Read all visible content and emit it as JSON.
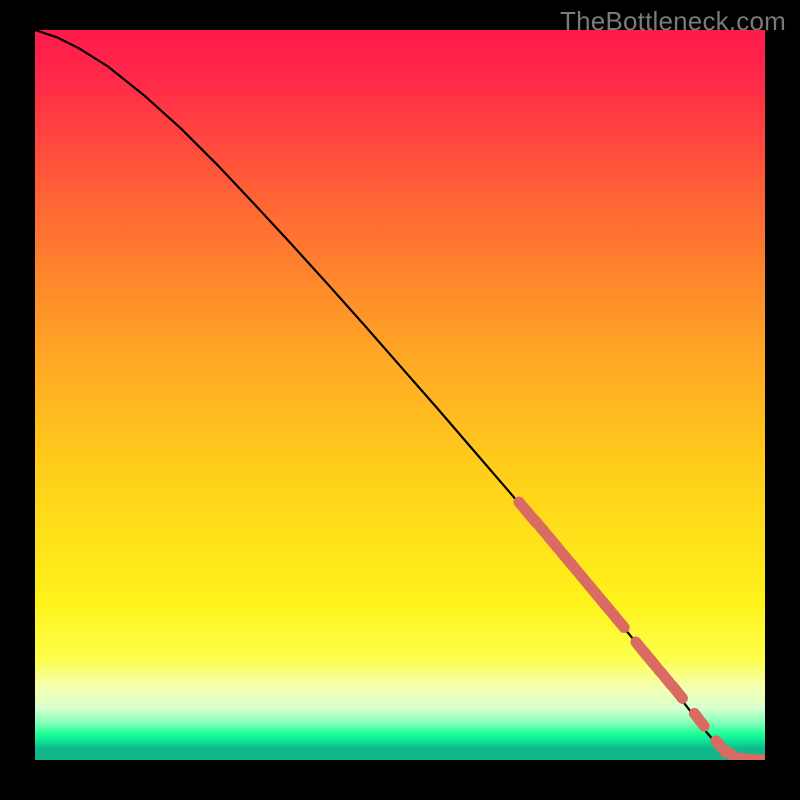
{
  "watermark": "TheBottleneck.com",
  "colors": {
    "background": "#000000",
    "gradient_stops": [
      {
        "offset": 0.0,
        "color": "#ff1a4d"
      },
      {
        "offset": 0.07,
        "color": "#ff2a48"
      },
      {
        "offset": 0.25,
        "color": "#ff6a33"
      },
      {
        "offset": 0.45,
        "color": "#ffa824"
      },
      {
        "offset": 0.62,
        "color": "#ffd21a"
      },
      {
        "offset": 0.78,
        "color": "#fff21a"
      },
      {
        "offset": 0.86,
        "color": "#fdff4a"
      },
      {
        "offset": 0.9,
        "color": "#f5ffb0"
      },
      {
        "offset": 0.93,
        "color": "#d6ffcf"
      },
      {
        "offset": 0.95,
        "color": "#7dffb6"
      },
      {
        "offset": 0.965,
        "color": "#1aff95"
      },
      {
        "offset": 0.975,
        "color": "#0de095"
      },
      {
        "offset": 0.985,
        "color": "#10b788"
      },
      {
        "offset": 1.0,
        "color": "#10b788"
      }
    ],
    "curve": "#000000",
    "marker_fill": "#d96b63",
    "marker_stroke": "#d96b63"
  },
  "chart_data": {
    "type": "line",
    "xlabel": "",
    "ylabel": "",
    "xlim": [
      0,
      100
    ],
    "ylim": [
      0,
      100
    ],
    "title": "",
    "series": [
      {
        "name": "bottleneck-curve",
        "x": [
          0,
          3,
          6,
          10,
          15,
          20,
          25,
          30,
          35,
          40,
          45,
          50,
          55,
          60,
          65,
          70,
          75,
          80,
          82,
          84,
          86,
          88,
          90,
          92,
          94,
          96,
          98,
          100
        ],
        "y": [
          100,
          99,
          97.5,
          95,
          91,
          86.5,
          81.5,
          76.2,
          70.8,
          65.3,
          59.7,
          54.0,
          48.3,
          42.5,
          36.7,
          30.8,
          24.9,
          18.9,
          16.5,
          14.0,
          11.5,
          9.0,
          6.4,
          3.8,
          1.5,
          0.3,
          0.1,
          0.0
        ]
      }
    ],
    "markers": {
      "name": "highlighted-points",
      "x": [
        67,
        68,
        69,
        70,
        71,
        72,
        73,
        74,
        75.5,
        76.5,
        77.5,
        78,
        79,
        80,
        83,
        84,
        85,
        86.5,
        88,
        91,
        94,
        96,
        98,
        100
      ],
      "y": [
        34.5,
        33.3,
        32.2,
        31.0,
        29.8,
        28.6,
        27.4,
        26.2,
        24.4,
        23.2,
        22.0,
        21.4,
        20.2,
        19.0,
        15.3,
        14.1,
        12.9,
        11.1,
        9.3,
        5.5,
        1.8,
        0.4,
        0.1,
        0.0
      ]
    }
  }
}
